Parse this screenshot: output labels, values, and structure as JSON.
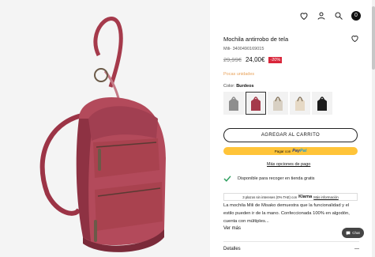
{
  "header": {
    "icons": [
      "heart-icon",
      "user-icon",
      "search-icon",
      "shopping-bag-icon"
    ],
    "bag_count": "0"
  },
  "product": {
    "title": "Mochila antirrobo de tela",
    "reference": "Mili- 3400490169015",
    "old_price": "29,99€",
    "new_price": "24,00€",
    "discount": "-20%",
    "stock": "Pocas unidades",
    "color_label": "Color: ",
    "color_value": "Burdeos",
    "swatches": [
      {
        "name": "Gris",
        "color": "#8e8e8e"
      },
      {
        "name": "Burdeos",
        "color": "#a53a4b"
      },
      {
        "name": "Beige",
        "color": "#d8d0c3"
      },
      {
        "name": "Crudo",
        "color": "#e6d9c5"
      },
      {
        "name": "Negro",
        "color": "#1c1c1c"
      }
    ],
    "selected_swatch_index": 1,
    "accent_color": "#a53a4b"
  },
  "actions": {
    "add_to_cart": "AGREGAR AL CARRITO",
    "paypal_prefix": "Pagar con",
    "paypal_brand_1": "Pay",
    "paypal_brand_2": "Pal",
    "payment_options": "Más opciones de pago"
  },
  "pickup": {
    "text": "Disponible para recoger en tienda gratis"
  },
  "klarna": {
    "text": "3 plazos sin intereses (0% TAE) con",
    "brand": "Klarna",
    "more": "Más información"
  },
  "description": {
    "text": "La mochila Mili de Misako demuestra que la funcionalidad y el estilo pueden ir de la mano. Confeccionada 100% en algodón, cuenta con múltiples...",
    "see_more": "Ver más"
  },
  "chat": {
    "label": "Chat"
  },
  "details": {
    "label": "Detalles",
    "toggle": "—"
  }
}
